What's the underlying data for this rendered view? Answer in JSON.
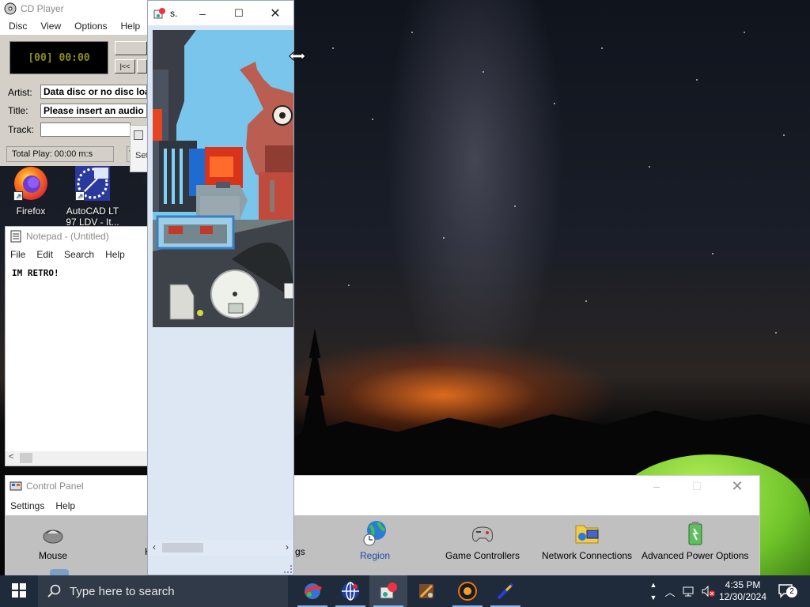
{
  "cd_player": {
    "title": "CD Player",
    "menu": [
      "Disc",
      "View",
      "Options",
      "Help"
    ],
    "display": "[00] 00:00",
    "artist_label": "Artist:",
    "artist_value": "Data disc or no disc loaded",
    "title_label": "Title:",
    "title_value": "Please insert an audio compact disc",
    "track_label": "Track:",
    "track_value": "",
    "status": "Total Play: 00:00 m:s"
  },
  "desktop_icons": [
    {
      "label": "Firefox",
      "icon": "firefox-icon"
    },
    {
      "label": "AutoCAD LT 97 LDV - It...",
      "icon": "autocad-icon"
    }
  ],
  "notepad": {
    "title": "Notepad - (Untitled)",
    "menu": [
      "File",
      "Edit",
      "Search",
      "Help"
    ],
    "content": "IM RETRO!"
  },
  "game_window": {
    "title": "s."
  },
  "hidden_window": {
    "title_fragment": "Set",
    "number_fragment": "4"
  },
  "control_panel": {
    "title": "Control Panel",
    "menu": [
      "Settings",
      "Help"
    ],
    "items": [
      {
        "label": "Mouse",
        "icon": "mouse-icon"
      },
      {
        "label": "Region",
        "icon": "globe-icon"
      },
      {
        "label": "Game Controllers",
        "icon": "gamepad-icon"
      },
      {
        "label": "Network Connections",
        "icon": "network-folder-icon"
      },
      {
        "label": "Advanced Power Options",
        "icon": "battery-icon"
      }
    ],
    "partial_labels": [
      "K",
      "gs"
    ]
  },
  "taskbar": {
    "search_placeholder": "Type here to search",
    "time": "4:35 PM",
    "date": "12/30/2024",
    "notification_count": "2",
    "apps": [
      "game-icon",
      "globe-icon",
      "control-panel-icon",
      "settings-icon",
      "media-icon",
      "pen-icon"
    ]
  },
  "colors": {
    "taskbar": "#1f2a3a",
    "search": "#303a48",
    "lcd_text": "#8e8e1a",
    "game_sky": "#79c5ec"
  }
}
